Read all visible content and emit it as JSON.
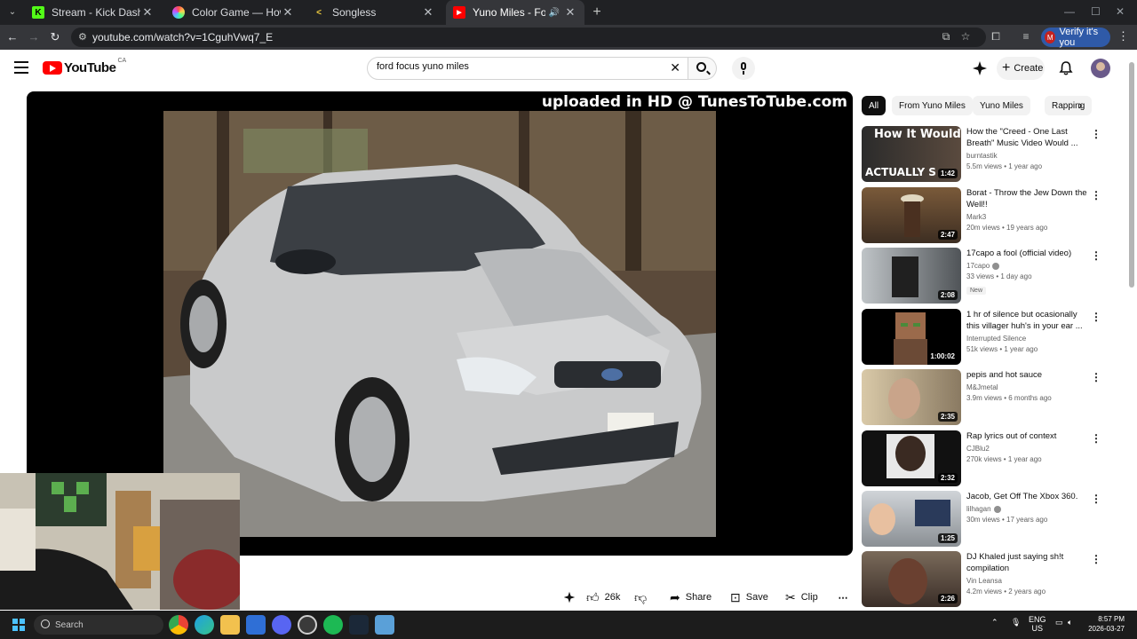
{
  "browser": {
    "tabs": [
      {
        "title": "Stream - Kick Dashboard"
      },
      {
        "title": "Color Game — How Well Can Y"
      },
      {
        "title": "Songless"
      },
      {
        "title": "Yuno Miles - Ford Focus (P"
      }
    ],
    "url": "youtube.com/watch?v=1CguhVwq7_E",
    "verify_label": "Verify it's you"
  },
  "youtube": {
    "logo_text": "YouTube",
    "country_code": "CA",
    "search_value": "ford focus yuno miles",
    "create_label": "Create"
  },
  "player": {
    "watermark": "uploaded in HD @ TunesToTube.com"
  },
  "actions": {
    "likes": "26k",
    "share": "Share",
    "save": "Save",
    "clip": "Clip"
  },
  "chips": [
    "All",
    "From Yuno Miles",
    "Yuno Miles",
    "Rapping"
  ],
  "related": [
    {
      "title": "How the \"Creed - One Last Breath\" Music Video Would ...",
      "channel": "burntastik",
      "stats": "5.5m views • 1 year ago",
      "duration": "1:42",
      "thumb_text_top": "How It Would",
      "thumb_text_bottom": "ACTUALLY S"
    },
    {
      "title": "Borat - Throw the Jew Down the Well!!",
      "channel": "Mark3",
      "stats": "20m views • 19 years ago",
      "duration": "2:47"
    },
    {
      "title": "17capo a fool (official video)",
      "channel": "17capo",
      "stats": "33 views • 1 day ago",
      "duration": "2:08",
      "badge": "New"
    },
    {
      "title": "1 hr of silence but ocasionally this villager huh's in your ear ...",
      "channel": "Interrupted Silence",
      "stats": "51k views • 1 year ago",
      "duration": "1:00:02"
    },
    {
      "title": "pepis and hot sauce",
      "channel": "M&Jmetal",
      "stats": "3.9m views • 6 months ago",
      "duration": "2:35"
    },
    {
      "title": "Rap lyrics out of context",
      "channel": "CJBlu2",
      "stats": "270k views • 1 year ago",
      "duration": "2:32"
    },
    {
      "title": "Jacob, Get Off The Xbox 360.",
      "channel": "lilhagan",
      "stats": "30m views • 17 years ago",
      "duration": "1:25"
    },
    {
      "title": "DJ Khaled just saying sh!t compilation",
      "channel": "Vin Leansa",
      "stats": "4.2m views • 2 years ago",
      "duration": "2:26"
    }
  ],
  "taskbar": {
    "search_placeholder": "Search",
    "lang_top": "ENG",
    "lang_bottom": "US",
    "time": "8:57 PM",
    "date": "2026-03-27"
  }
}
